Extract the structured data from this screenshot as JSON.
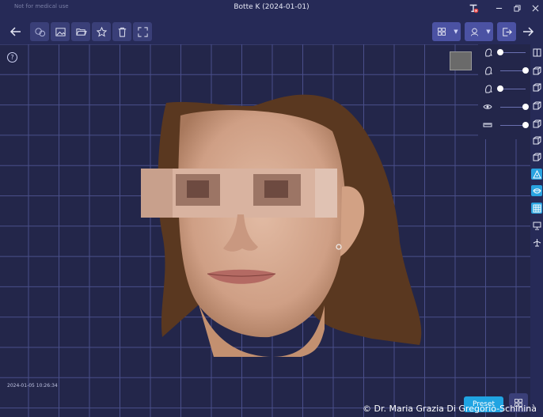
{
  "titlebar": {
    "notice": "Not for medical use",
    "title": "Botte K (2024-01-01)"
  },
  "toolbar": {
    "left_buttons": [
      "back-arrow-icon",
      "capture-icon",
      "image-icon",
      "folder-open-icon",
      "star-icon",
      "trash-icon",
      "fullscreen-icon"
    ],
    "right_buttons": [
      "layout-grid-icon",
      "bust-icon",
      "exit-icon",
      "forward-arrow-icon"
    ]
  },
  "viewport": {
    "help_symbol": "?",
    "sliders": [
      {
        "icon": "head-profile-icon",
        "level": 0.0
      },
      {
        "icon": "head-profile-icon",
        "level": 1.0
      },
      {
        "icon": "head-profile-icon",
        "level": 0.0
      },
      {
        "icon": "eye-icon",
        "level": 1.0
      },
      {
        "icon": "ruler-icon",
        "level": 1.0
      }
    ],
    "right_tools": [
      {
        "icon": "cube-front-icon",
        "active": false
      },
      {
        "icon": "cube-icon",
        "active": false
      },
      {
        "icon": "cube-icon",
        "active": false
      },
      {
        "icon": "cube-icon",
        "active": false
      },
      {
        "icon": "cube-icon",
        "active": false
      },
      {
        "icon": "cube-icon",
        "active": false
      },
      {
        "icon": "cube-icon",
        "active": false
      },
      {
        "icon": "landmark-icon",
        "active": true
      },
      {
        "icon": "lips-icon",
        "active": true
      },
      {
        "icon": "grid-icon",
        "active": true
      },
      {
        "icon": "monitor-icon",
        "active": false
      },
      {
        "icon": "plane-icon",
        "active": false
      }
    ],
    "timestamp": "2024-01-05 10:26:34",
    "preset_label": "Preset",
    "copyright": "© Dr. Maria Grazia Di Gregorio-Schininà"
  },
  "colors": {
    "background": "#23264a",
    "toolbar": "#262a57",
    "grid_line": "#4a4f8a",
    "accent": "#20a4e2",
    "button": "#3a3f78",
    "dropdown": "#4b52a3"
  }
}
